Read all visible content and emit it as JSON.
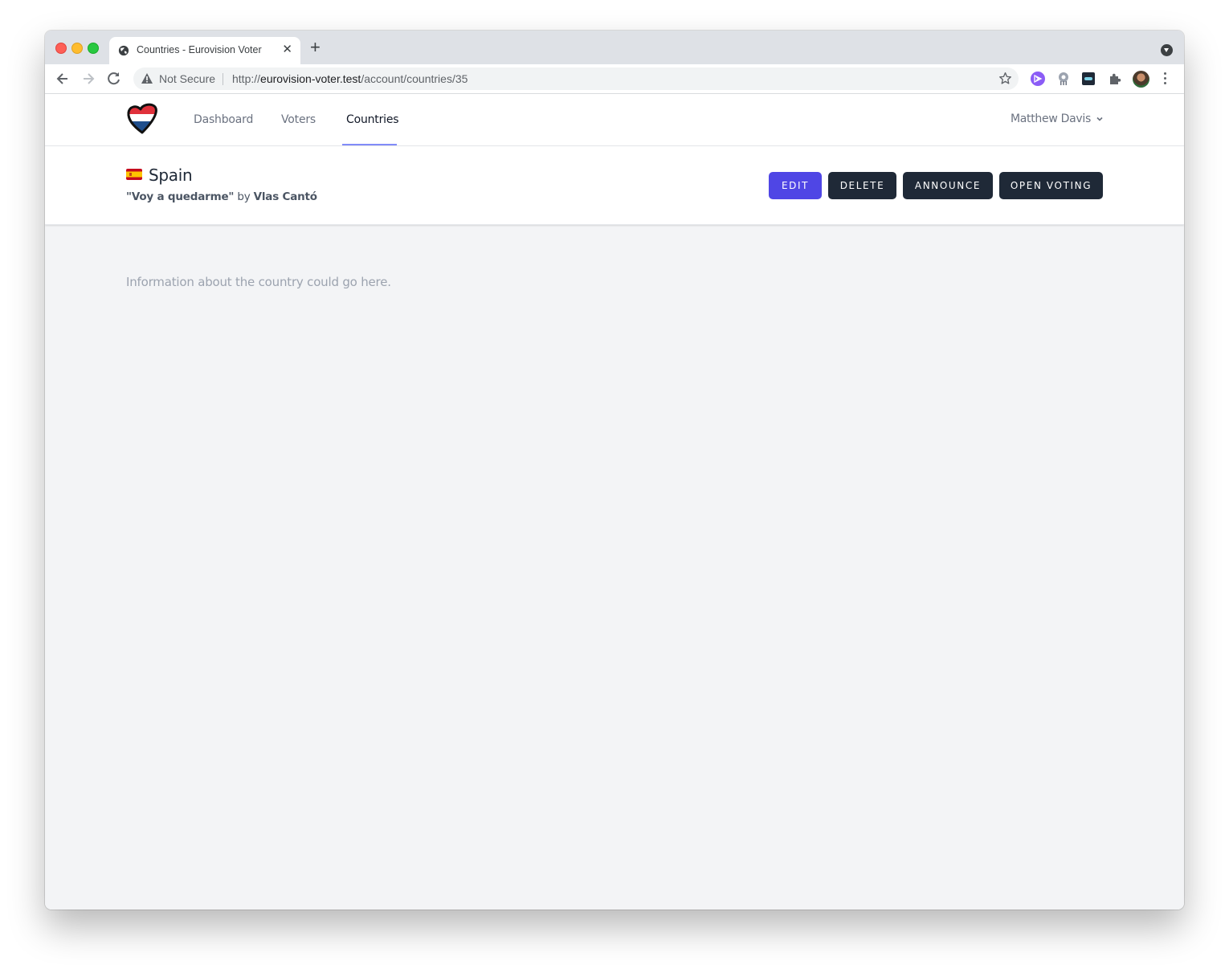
{
  "browser": {
    "tab_title": "Countries - Eurovision Voter",
    "new_tab_label": "+",
    "close_tab_label": "✕",
    "security_label": "Not Secure",
    "url_scheme": "http://",
    "url_host": "eurovision-voter.test",
    "url_path": "/account/countries/35",
    "extensions": [
      "purple-circle-extension",
      "robot-extension",
      "cloud-extension",
      "puzzle-extensions-icon"
    ],
    "profile": "profile-avatar"
  },
  "nav": {
    "logo_alt": "Eurovision heart logo",
    "links": [
      {
        "label": "Dashboard",
        "active": false
      },
      {
        "label": "Voters",
        "active": false
      },
      {
        "label": "Countries",
        "active": true
      }
    ],
    "user_name": "Matthew Davis",
    "accent_color": "#818cf8"
  },
  "header": {
    "flag_emoji": "🇪🇸",
    "country": "Spain",
    "song": "\"Voy a quedarme\"",
    "by": "by",
    "artist": "Vlas Cantó",
    "buttons": {
      "edit": "EDIT",
      "delete": "DELETE",
      "announce": "ANNOUNCE",
      "open_voting": "OPEN VOTING"
    },
    "colors": {
      "primary": "#4f46e5",
      "dark": "#1f2937"
    }
  },
  "main": {
    "info_text": "Information about the country could go here."
  }
}
